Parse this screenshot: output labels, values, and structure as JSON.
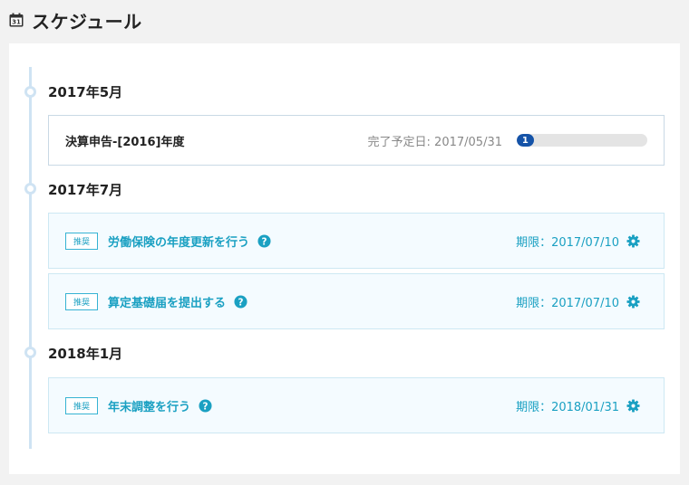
{
  "header": {
    "title": "スケジュール",
    "icon": "calendar-icon",
    "icon_day": "31"
  },
  "colors": {
    "accent": "#1aa0c2",
    "progress": "#1553a8",
    "timeline": "#cfe3f3",
    "reco_bg": "#f4fbff"
  },
  "schedule": [
    {
      "month": "2017年5月",
      "items": [
        {
          "title": "決算申告-[2016]年度",
          "due": "完了予定日: 2017/05/31",
          "progress_label": "1",
          "progress_fraction": 0.13
        }
      ]
    },
    {
      "month": "2017年7月",
      "items": [
        {
          "badge": "推奨",
          "title": "労働保険の年度更新を行う",
          "due": "期限：2017/07/10"
        },
        {
          "badge": "推奨",
          "title": "算定基礎届を提出する",
          "due": "期限：2017/07/10"
        }
      ]
    },
    {
      "month": "2018年1月",
      "items": [
        {
          "badge": "推奨",
          "title": "年末調整を行う",
          "due": "期限：2018/01/31"
        }
      ]
    }
  ]
}
